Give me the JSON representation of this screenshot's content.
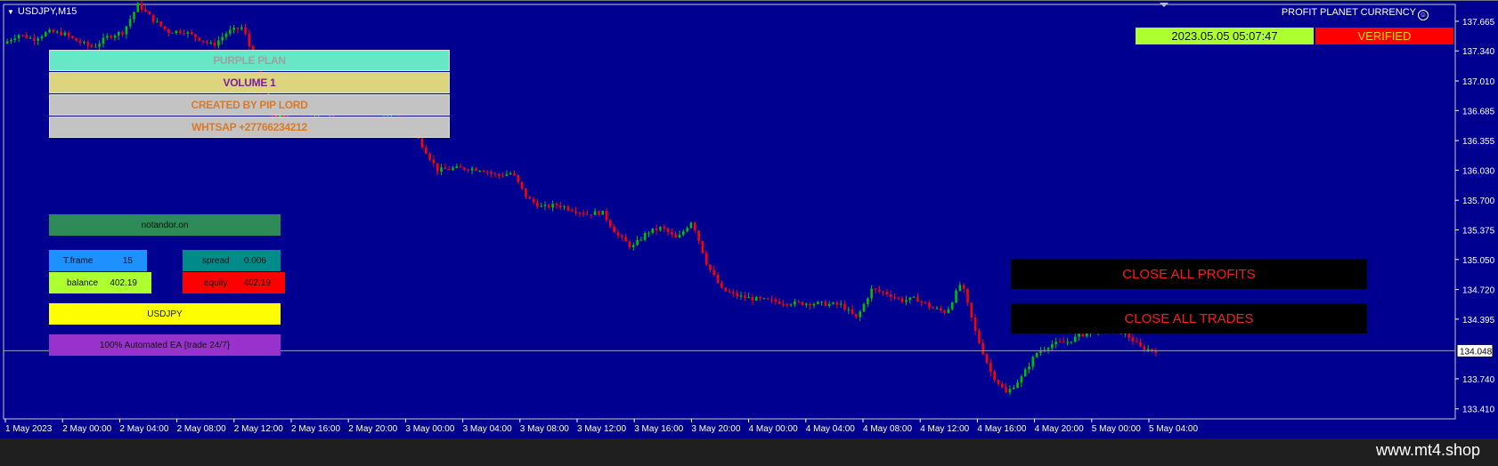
{
  "window": {
    "title": "USDJPY,M15",
    "brand": "PROFIT PLANET CURRENCY",
    "footer": "www.mt4.shop"
  },
  "header_panels": [
    {
      "text": "PURPLE PLAN",
      "bg": "#66e8c7",
      "color": "#a0a0a0"
    },
    {
      "text": "VOLUME 1",
      "bg": "#dcd57e",
      "color": "#7a1fa0"
    },
    {
      "text": "CREATED BY PIP LORD",
      "bg": "#c3c3c3",
      "color": "#d87a2a"
    },
    {
      "text": "WHTSAP +27766234212",
      "bg": "#c3c3c3",
      "color": "#d87a2a"
    }
  ],
  "info": {
    "server": "notandor.on",
    "tframe_label": "T.frame",
    "tframe_value": "15",
    "spread_label": "spread",
    "spread_value": "0.006",
    "balance_label": "balance",
    "balance_value": "402.19",
    "equity_label": "equity",
    "equity_value": "402.19",
    "symbol": "USDJPY",
    "ea_note": "100% Automated EA {trade 24/7}"
  },
  "colors": {
    "chart_bg": "#000090",
    "bull": "#00c000",
    "bear": "#ff0000",
    "server": "#2e8b57",
    "tframe": "#1e90ff",
    "spread": "#008b8b",
    "balance": "#adff2f",
    "equity": "#ff0000",
    "symbol": "#ffff00",
    "ea": "#9932cc"
  },
  "status": {
    "datetime": "2023.05.05 05:07:47",
    "verified": "VERIFIED"
  },
  "buttons": {
    "close_profits": "CLOSE ALL PROFITS",
    "close_trades": "CLOSE ALL TRADES"
  },
  "chart_data": {
    "type": "candlestick",
    "symbol": "USDJPY",
    "timeframe": "M15",
    "price_ticks": [
      "137.665",
      "137.340",
      "137.010",
      "136.685",
      "136.355",
      "136.030",
      "135.700",
      "135.375",
      "135.050",
      "134.720",
      "134.395",
      "133.740",
      "133.410"
    ],
    "current_price": "134.048",
    "ylim": [
      133.3,
      137.85
    ],
    "time_ticks": [
      "1 May 2023",
      "2 May 00:00",
      "2 May 04:00",
      "2 May 08:00",
      "2 May 12:00",
      "2 May 16:00",
      "2 May 20:00",
      "3 May 00:00",
      "3 May 04:00",
      "3 May 08:00",
      "3 May 12:00",
      "3 May 16:00",
      "3 May 20:00",
      "4 May 00:00",
      "4 May 04:00",
      "4 May 08:00",
      "4 May 12:00",
      "4 May 16:00",
      "4 May 20:00",
      "5 May 00:00",
      "5 May 04:00"
    ],
    "close_path": [
      137.42,
      137.52,
      137.47,
      137.55,
      137.53,
      137.44,
      137.38,
      137.5,
      137.55,
      137.85,
      137.68,
      137.55,
      137.56,
      137.48,
      137.4,
      137.55,
      137.6,
      137.12,
      136.62,
      136.6,
      136.57,
      136.63,
      136.58,
      136.56,
      136.56,
      136.57,
      136.6,
      136.55,
      136.3,
      136.03,
      136.05,
      136.05,
      136.04,
      135.97,
      136.0,
      135.72,
      135.62,
      135.65,
      135.6,
      135.55,
      135.57,
      135.32,
      135.18,
      135.35,
      135.4,
      135.27,
      135.48,
      135.0,
      134.72,
      134.65,
      134.62,
      134.6,
      134.58,
      134.57,
      134.57,
      134.56,
      134.55,
      134.4,
      134.72,
      134.68,
      134.6,
      134.62,
      134.52,
      134.47,
      134.8,
      134.22,
      133.8,
      133.58,
      133.75,
      134.02,
      134.12,
      134.14,
      134.22,
      134.28,
      134.3,
      134.23,
      134.08,
      134.05
    ]
  }
}
